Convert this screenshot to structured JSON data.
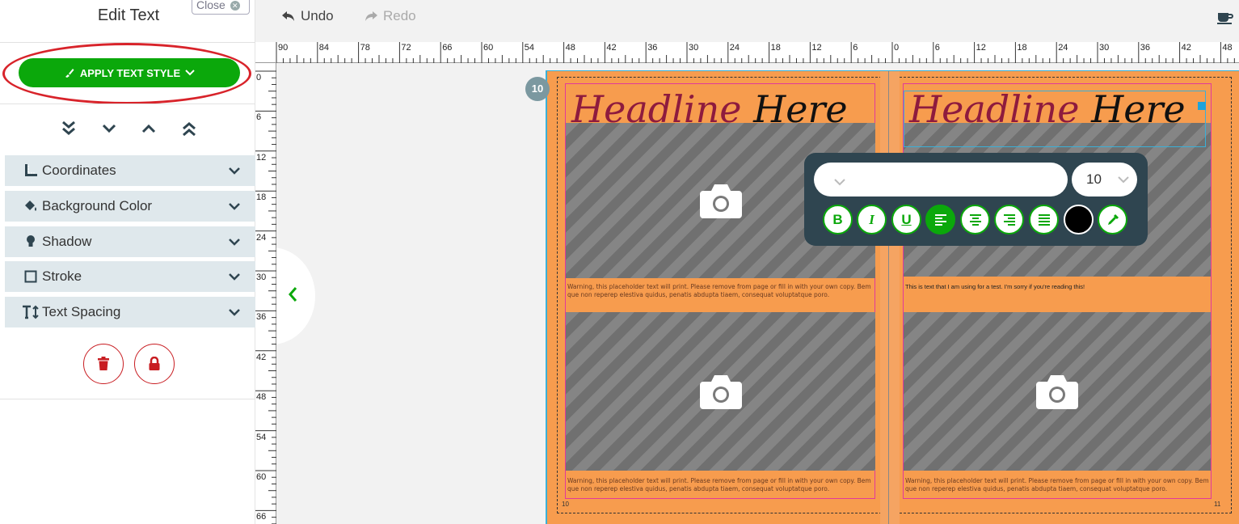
{
  "sidebar": {
    "title": "Edit Text",
    "close_label": "Close",
    "apply_text_style": "APPLY TEXT STYLE",
    "sections": [
      {
        "label": "Coordinates",
        "icon": "ruler-icon"
      },
      {
        "label": "Background Color",
        "icon": "paint-bucket-icon"
      },
      {
        "label": "Shadow",
        "icon": "lightbulb-icon"
      },
      {
        "label": "Stroke",
        "icon": "square-outline-icon"
      },
      {
        "label": "Text Spacing",
        "icon": "text-height-icon"
      }
    ]
  },
  "toolbar": {
    "undo": "Undo",
    "redo": "Redo"
  },
  "rulers": {
    "horizontal": [
      "90",
      "84",
      "78",
      "72",
      "66",
      "60",
      "54",
      "48",
      "42",
      "36",
      "30",
      "24",
      "18",
      "12",
      "6",
      "0",
      "6",
      "12",
      "18",
      "24",
      "30",
      "36",
      "42",
      "48"
    ],
    "vertical": [
      "0",
      "6",
      "12",
      "18",
      "24",
      "30",
      "36",
      "42",
      "48",
      "54",
      "60",
      "66"
    ]
  },
  "spread": {
    "badge": "10",
    "left_page": {
      "headline_part1": "Headline",
      "headline_part2": "Here",
      "caption_top": "Warning, this placeholder text will print. Please remove from page or fill in with your own copy. Bem que non reperep elestiva quidus, penatis abdupta tiaem, consequat voluptatque poro.",
      "caption_bottom": "Warning, this placeholder text will print. Please remove from page or fill in with your own copy. Bem que non reperep elestiva quidus, penatis abdupta tiaem, consequat voluptatque poro.",
      "page_number": "10"
    },
    "right_page": {
      "headline_part1": "Headline",
      "headline_part2": "Here",
      "caption_top": "This is text that I am using for a test. I'm sorry if you're reading this!",
      "caption_bottom": "Warning, this placeholder text will print. Please remove from page or fill in with your own copy. Bem que non reperep elestiva quidus, penatis abdupta tiaem, consequat voluptatque poro.",
      "page_number": "11"
    }
  },
  "text_toolbar": {
    "font_value": "",
    "font_size": "10",
    "buttons": [
      "bold",
      "italic",
      "underline",
      "align-left",
      "align-center",
      "align-right",
      "justify",
      "color",
      "eyedropper"
    ],
    "active_button": "align-left",
    "text_color": "#000000"
  },
  "colors": {
    "accent": "#0ba80b",
    "danger": "#c81d22",
    "page": "#f79c4e",
    "headline": "#8e1b3e",
    "toolbar_bg": "#2f4550"
  }
}
